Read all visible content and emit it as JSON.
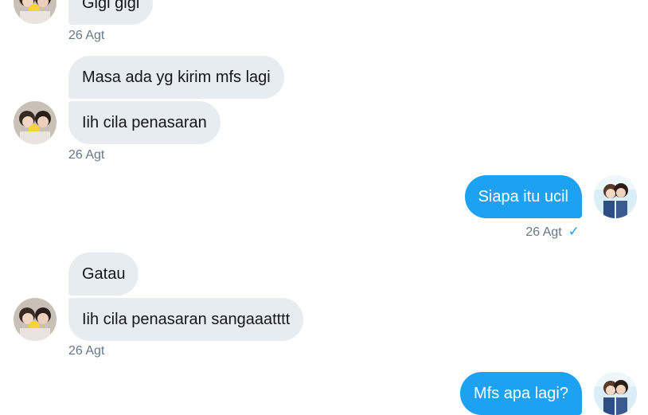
{
  "messages": {
    "m1": {
      "text": "Gigi gigi",
      "time": "26 Agt"
    },
    "m2a": {
      "text": "Masa ada yg kirim mfs lagi"
    },
    "m2b": {
      "text": "Iih cila penasaran",
      "time": "26 Agt"
    },
    "m3": {
      "text": "Siapa itu ucil",
      "time": "26 Agt",
      "status_icon": "checkmark-icon"
    },
    "m4a": {
      "text": "Gatau"
    },
    "m4b": {
      "text": "Iih cila penasaran sangaaatttt",
      "time": "26 Agt"
    },
    "m5": {
      "text": "Mfs apa lagi?"
    }
  },
  "glyphs": {
    "check": "✓"
  },
  "colors": {
    "incoming_bubble": "#e6ecf0",
    "outgoing_bubble": "#1da1f2",
    "timestamp": "#657786",
    "accent": "#1da1f2"
  }
}
